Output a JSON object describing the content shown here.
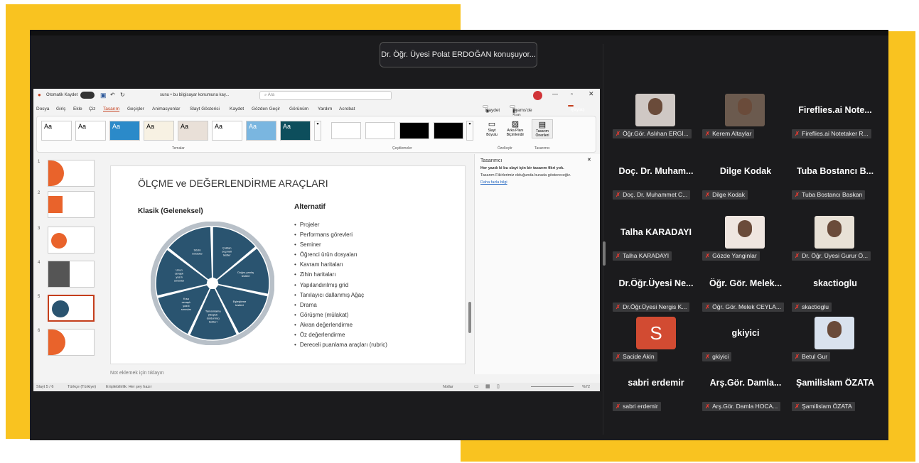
{
  "meeting": {
    "speaking_banner": "Dr. Öğr. Üyesi Polat ERDOĞAN konuşuyor..."
  },
  "ppt": {
    "autosave": "Otomatik Kaydet",
    "doc_title": "sunu • bu bilgisayar konumuna kay...",
    "search": "Ara",
    "menu": [
      "Dosya",
      "Giriş",
      "Ekle",
      "Çiz",
      "Tasarım",
      "Geçişler",
      "Animasyonlar",
      "Slayt Gösterisi",
      "Kaydet",
      "Gözden Geçir",
      "Görünüm",
      "Yardım",
      "Acrobat"
    ],
    "record_btn": "Kaydet",
    "teams_btn": "Teams'de Sun",
    "share_btn": "Paylaş",
    "themes_label": "Temalar",
    "variants_label": "Çeşitlemeler",
    "customize_label": "Özelleştir",
    "designer_label": "Tasarımcı",
    "theme_sample": "Aa",
    "ribbon_buttons": [
      "Slayt Boyutu",
      "Arka Planı Biçimlendir",
      "Tasarım Önerileri"
    ],
    "slide_numbers": [
      "1",
      "2",
      "3",
      "4",
      "5",
      "6"
    ],
    "slide": {
      "title": "ÖLÇME ve DEĞERLENDİRME ARAÇLARI",
      "left_heading": "Klasik (Geleneksel)",
      "right_heading": "Alternatif",
      "items": [
        "Projeler",
        "Performans görevleri",
        "Seminer",
        "Öğrenci ürün dosyaları",
        "Kavram haritaları",
        "Zihin haritaları",
        "Yapılandırılmış grid",
        "Tanılayıcı dallanmış Ağaç",
        "Drama",
        "Görüşme (mülakat)",
        "Akran değerlendirme",
        "Öz değerlendirme",
        "Dereceli puanlama araçları (rubric)"
      ],
      "cycle": [
        "Çoktan seçmeli testler",
        "Doğru-yanlış testleri",
        "Eşleştirme testleri",
        "Tamamlama (Boşluk doldurma) testleri",
        "Kısa cevaplı yazılı sınavlar",
        "Uzun cevaplı yazılı sınavlar",
        "Sözlü Sınavlar"
      ]
    },
    "notes_hint": "Not eklemek için tıklayın",
    "status": {
      "slide": "Slayt 5 / 6",
      "lang": "Türkçe (Türkiye)",
      "access": "Erişilebilirlik: Her şey hazır",
      "notes": "Notlar",
      "zoom": "%72"
    },
    "designer": {
      "title": "Tasarımcı",
      "msg1": "Her yazdı ki bu slayt için bir tasarım fikri yok.",
      "msg2": "Tasarım Fikirlerimiz olduğunda burada göstereceğiz.",
      "link": "Daha fazla bilgi"
    }
  },
  "participants": [
    {
      "name": "",
      "label": "Öğr.Gör. Aslıhan ERGİ..."
    },
    {
      "name": "",
      "label": "Kerem Altaylar"
    },
    {
      "name": "Fireflies.ai Note...",
      "label": "Fireflies.ai Notetaker R..."
    },
    {
      "name": "Doç. Dr. Muham...",
      "label": "Doç. Dr. Muhammet C..."
    },
    {
      "name": "Dilge Kodak",
      "label": "Dilge Kodak"
    },
    {
      "name": "Tuba Bostancı B...",
      "label": "Tuba Bostancı Baskan"
    },
    {
      "name": "Talha KARADAYI",
      "label": "Talha KARADAYI"
    },
    {
      "name": "",
      "label": "Gözde Yanginlar"
    },
    {
      "name": "",
      "label": "Dr. Öğr. Üyesi Gurur Ö..."
    },
    {
      "name": "Dr.Öğr.Üyesi Ne...",
      "label": "Dr.Öğr.Üyesi Nergis K..."
    },
    {
      "name": "Öğr. Gör. Melek...",
      "label": "Öğr. Gör. Melek CEYLA..."
    },
    {
      "name": "skactioglu",
      "label": "skactioglu"
    },
    {
      "name": "",
      "label": "Sacide Akin",
      "avatar": "S"
    },
    {
      "name": "gkiyici",
      "label": "gkiyici"
    },
    {
      "name": "",
      "label": "Betul Gur"
    },
    {
      "name": "sabri erdemir",
      "label": "sabri erdemir"
    },
    {
      "name": "Arş.Gör. Damla...",
      "label": "Arş.Gör. Damla HOCA..."
    },
    {
      "name": "Şamilislam ÖZATA",
      "label": "Şamilislam ÖZATA"
    }
  ],
  "colors": {
    "accent_yellow": "#f9c320",
    "meeting_bg": "#1b1b1d",
    "mic_muted": "#ff3b30"
  }
}
